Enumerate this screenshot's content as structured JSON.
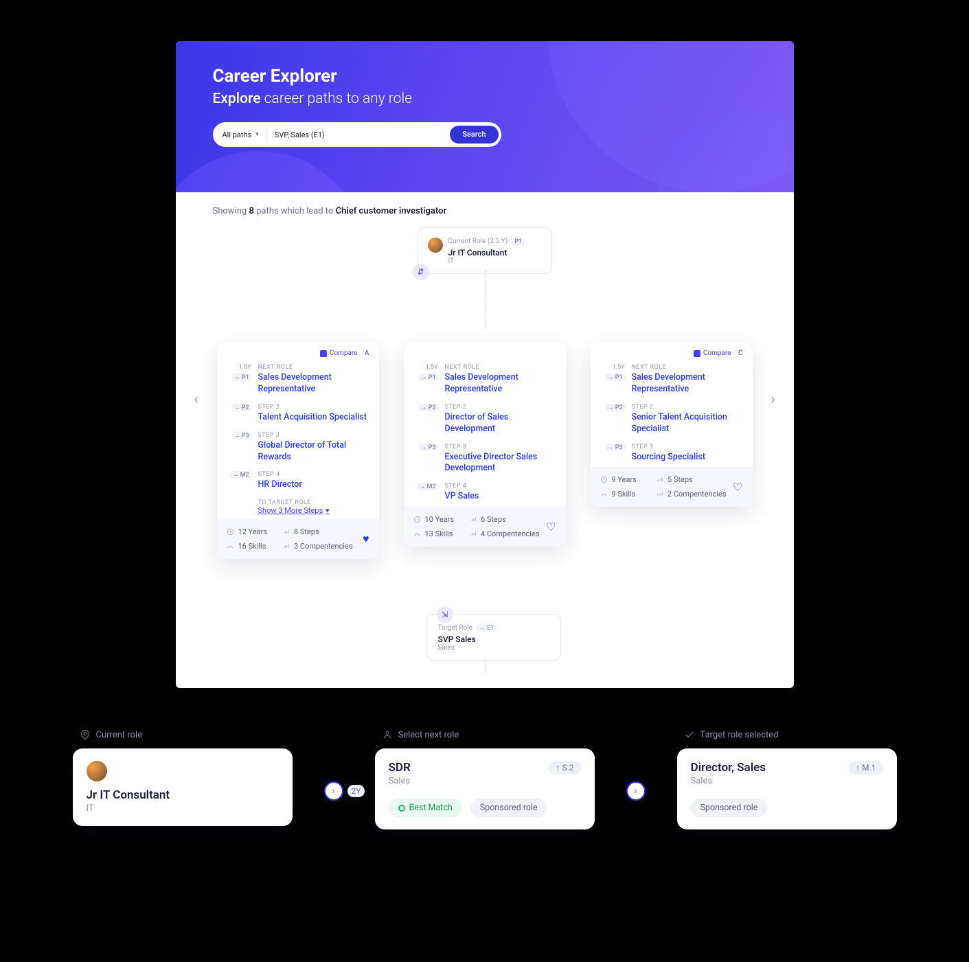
{
  "hero": {
    "title": "Career Explorer",
    "subtitle_lead": "Explore",
    "subtitle_rest": "career paths to any role",
    "filter_label": "All paths",
    "search_value": "SVP, Sales (E1)",
    "search_button": "Search"
  },
  "paths_info": {
    "prefix": "Showing",
    "count": "8",
    "middle": "paths which lead to",
    "target": "Chief customer investigator"
  },
  "current_role": {
    "meta": "Current Role (2.5 Y)",
    "level": "P1",
    "title": "Jr IT Consultant",
    "dept": "IT"
  },
  "compare_label": "Compare",
  "next_role_label": "NEXT ROLE",
  "target_role_label": "TO TARGET ROLE",
  "show_more": "Show 3 More Steps",
  "path_a": {
    "letter": "A",
    "dur": "1.5Y",
    "steps": [
      {
        "chip": "→ P1",
        "label": "NEXT ROLE",
        "role": "Sales Development Representative"
      },
      {
        "chip": "→ P2",
        "label": "STEP 2",
        "role": "Talent Acquisition Specialist"
      },
      {
        "chip": "→ P3",
        "label": "STEP 3",
        "role": "Global Director of Total Rewards"
      },
      {
        "chip": "→ M2",
        "label": "STEP 4",
        "role": "HR Director"
      }
    ],
    "stats": {
      "years": "12 Years",
      "steps": "8 Steps",
      "skills": "16 Skills",
      "comps": "3 Compentencies"
    }
  },
  "path_b": {
    "dur": "1.5Y",
    "steps": [
      {
        "chip": "→ P1",
        "label": "NEXT ROLE",
        "role": "Sales Development Representative"
      },
      {
        "chip": "→ P2",
        "label": "STEP 2",
        "role": "Director of Sales Development"
      },
      {
        "chip": "→ P3",
        "label": "STEP 3",
        "role": "Executive Director Sales Development"
      },
      {
        "chip": "→ M2",
        "label": "STEP 4",
        "role": "VP Sales"
      }
    ],
    "stats": {
      "years": "10 Years",
      "steps": "6 Steps",
      "skills": "13 Skills",
      "comps": "4 Compentencies"
    }
  },
  "path_c": {
    "letter": "C",
    "dur": "1.5Y",
    "steps": [
      {
        "chip": "→ P1",
        "label": "NEXT ROLE",
        "role": "Sales Development Representative"
      },
      {
        "chip": "→ P2",
        "label": "STEP 2",
        "role": "Senior Talent Acquisition Specialist"
      },
      {
        "chip": "→ P3",
        "label": "STEP 3",
        "role": "Sourcing Specialist"
      }
    ],
    "stats": {
      "years": "9 Years",
      "steps": "5 Steps",
      "skills": "9 Skills",
      "comps": "2 Compentencies"
    }
  },
  "target_node": {
    "meta": "Target Role",
    "level": "→ E1",
    "title": "SVP Sales",
    "dept": "Sales"
  },
  "bottom": {
    "current": {
      "hdr": "Current role",
      "title": "Jr IT Consultant",
      "dept": "IT"
    },
    "next": {
      "hdr": "Select next role",
      "dur": "2Y",
      "title": "SDR",
      "dept": "Sales",
      "level": "↑ S.2",
      "pill_best": "Best Match",
      "pill_sponsored": "Sponsored role"
    },
    "target": {
      "hdr": "Target role selected",
      "title": "Director, Sales",
      "dept": "Sales",
      "level": "↑ M.1",
      "pill_sponsored": "Sponsored role"
    }
  }
}
